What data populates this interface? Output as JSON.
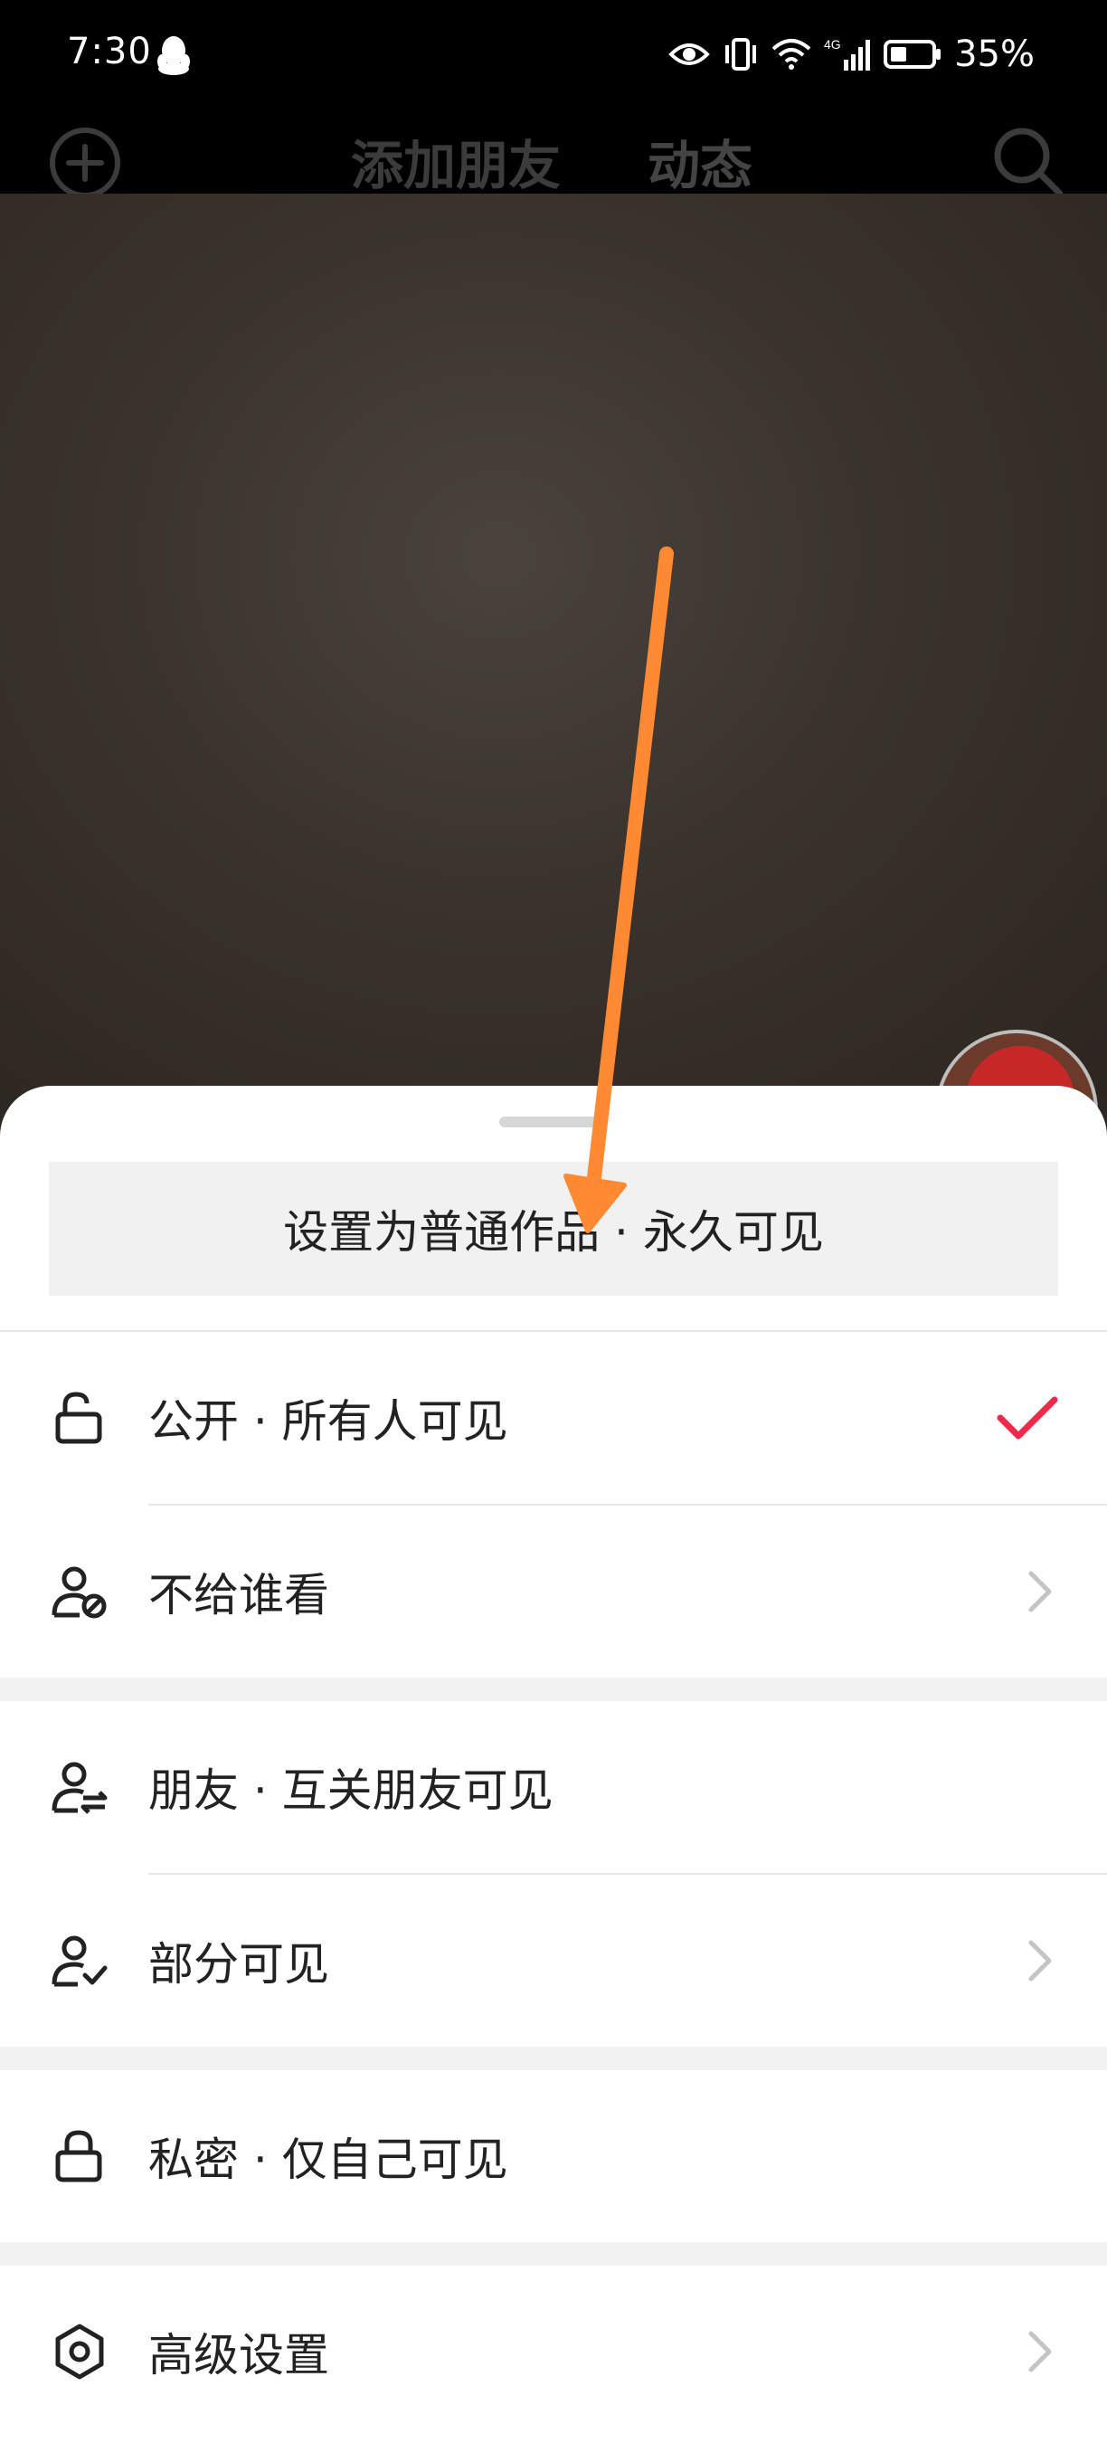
{
  "status_bar": {
    "time": "7:30",
    "network": "4G",
    "battery": "35%"
  },
  "nav": {
    "tab_add_friends": "添加朋友",
    "tab_feed": "动态"
  },
  "sheet": {
    "banner": "设置为普通作品 · 永久可见",
    "options": {
      "public": {
        "label": "公开 · 所有人可见",
        "selected": true
      },
      "hide_from": {
        "label": "不给谁看"
      },
      "friends": {
        "label": "朋友 · 互关朋友可见"
      },
      "partial": {
        "label": "部分可见"
      },
      "private": {
        "label": "私密 · 仅自己可见"
      },
      "advanced": {
        "label": "高级设置"
      }
    }
  },
  "colors": {
    "check": "#f0284a",
    "arrow": "#ff8a33"
  },
  "icons": [
    "qq-icon",
    "eye-icon",
    "vibrate-icon",
    "wifi-icon",
    "signal-icon",
    "battery-icon",
    "add-circle-icon",
    "search-icon",
    "unlock-icon",
    "user-block-icon",
    "user-swap-icon",
    "user-check-icon",
    "lock-icon",
    "settings-hexagon-icon",
    "chevron-right-icon",
    "checkmark-icon"
  ]
}
